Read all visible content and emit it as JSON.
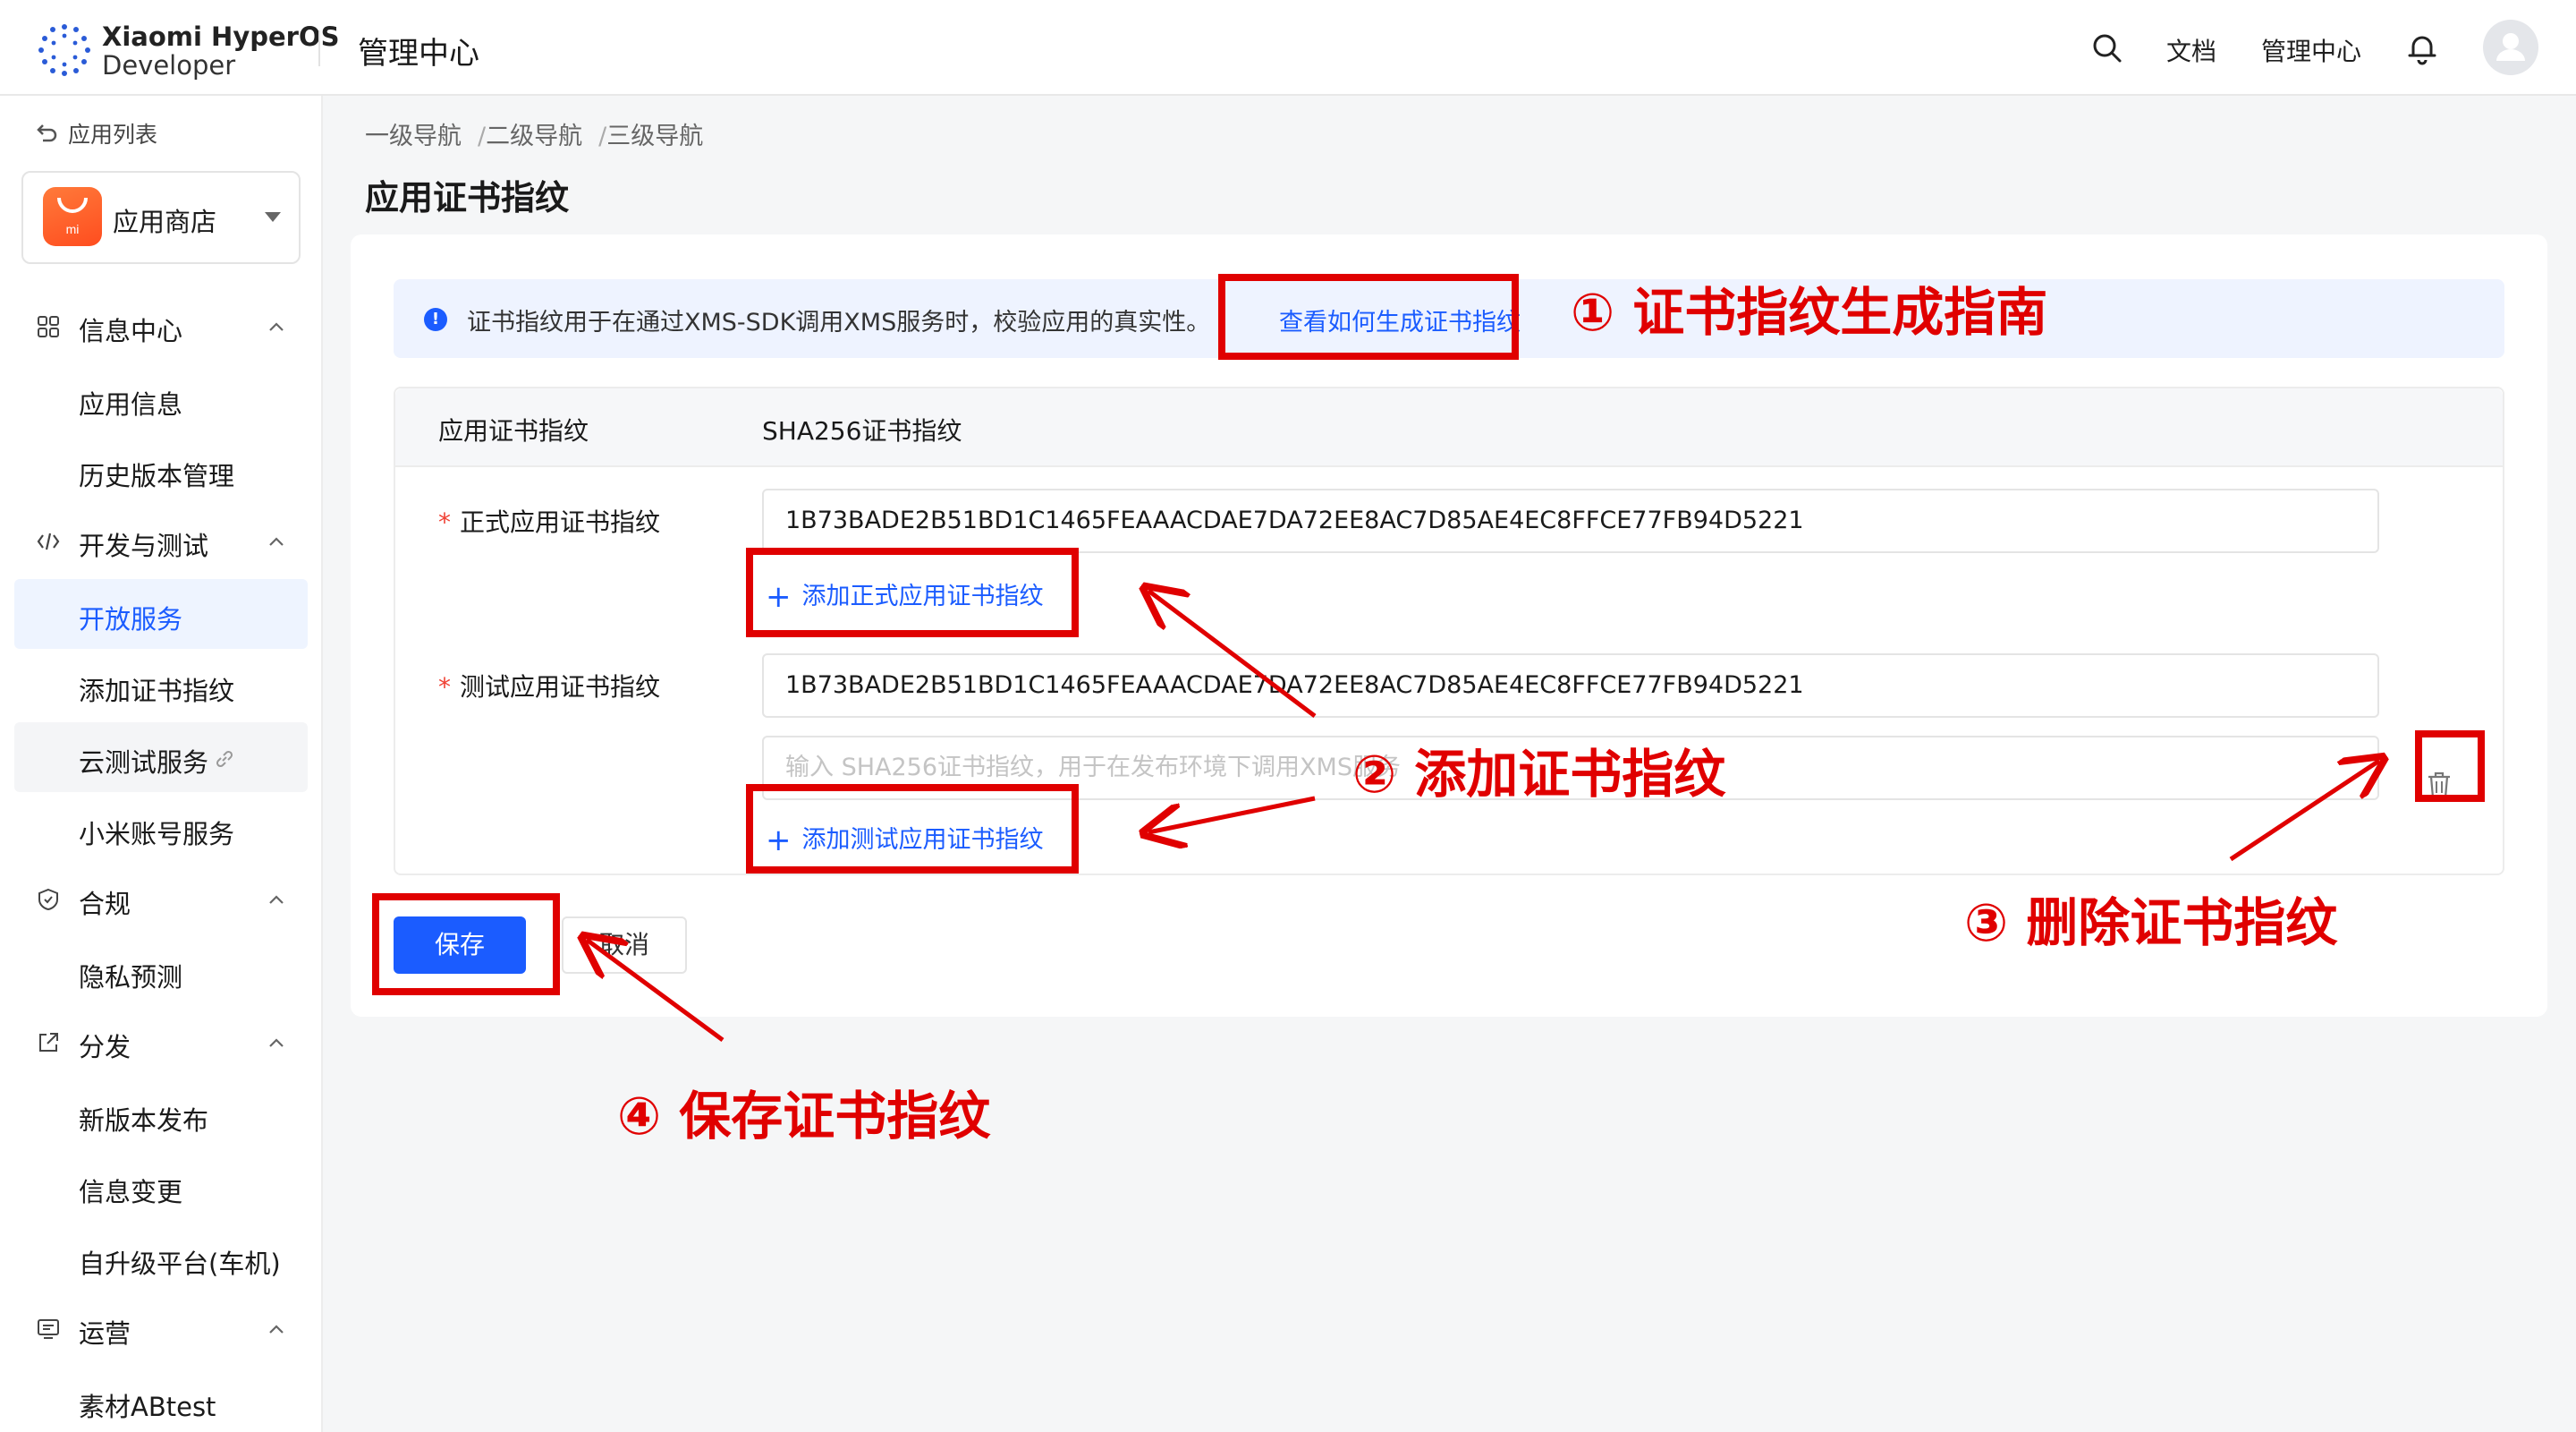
{
  "topbar": {
    "brand_line1": "Xiaomi HyperOS",
    "brand_line2": "Developer",
    "title": "管理中心",
    "links": [
      "文档",
      "管理中心"
    ]
  },
  "sidebar": {
    "back_label": "应用列表",
    "app_name": "应用商店",
    "groups": [
      {
        "label": "信息中心",
        "icon": "grid-icon",
        "items": [
          "应用信息",
          "历史版本管理"
        ]
      },
      {
        "label": "开发与测试",
        "icon": "code-icon",
        "items": [
          "开放服务",
          "添加证书指纹",
          "云测试服务",
          "小米账号服务"
        ]
      },
      {
        "label": "合规",
        "icon": "shield-icon",
        "items": [
          "隐私预测"
        ]
      },
      {
        "label": "分发",
        "icon": "share-icon",
        "items": [
          "新版本发布",
          "信息变更",
          "自升级平台(车机)"
        ]
      },
      {
        "label": "运营",
        "icon": "monitor-icon",
        "items": [
          "素材ABtest"
        ]
      }
    ],
    "active_item": "开放服务"
  },
  "breadcrumb": [
    "一级导航",
    "二级导航",
    "三级导航"
  ],
  "page_title": "应用证书指纹",
  "info": {
    "text": "证书指纹用于在通过XMS-SDK调用XMS服务时，校验应用的真实性。",
    "link": "查看如何生成证书指纹"
  },
  "table": {
    "col1": "应用证书指纹",
    "col2": "SHA256证书指纹",
    "release_label": "正式应用证书指纹",
    "release_value": "1B73BADE2B51BD1C1465FEAAACDAE7DA72EE8AC7D85AE4EC8FFCE77FB94D5221",
    "add_release": "添加正式应用证书指纹",
    "test_label": "测试应用证书指纹",
    "test_value": "1B73BADE2B51BD1C1465FEAAACDAE7DA72EE8AC7D85AE4EC8FFCE77FB94D5221",
    "test_placeholder": "输入 SHA256证书指纹，用于在发布环境下调用XMS服务",
    "add_test": "添加测试应用证书指纹"
  },
  "buttons": {
    "save": "保存",
    "cancel": "取消"
  },
  "annotations": {
    "a1": "① 证书指纹生成指南",
    "a2": "② 添加证书指纹",
    "a3": "③ 删除证书指纹",
    "a4": "④ 保存证书指纹",
    "color": "#e00000"
  },
  "colors": {
    "accent": "#1b5cff",
    "required": "#f04134"
  }
}
